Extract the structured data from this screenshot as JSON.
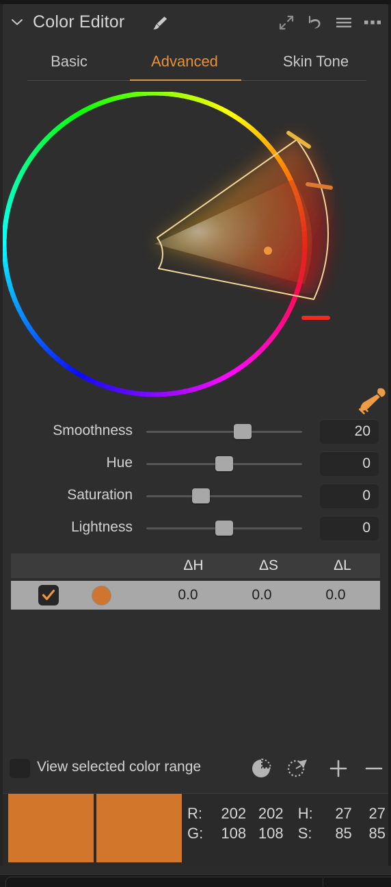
{
  "header": {
    "title": "Color Editor",
    "collapse_icon": "chevron-down-icon",
    "brush_icon": "paintbrush-icon",
    "actions": [
      {
        "name": "expand-icon",
        "label": "Expand"
      },
      {
        "name": "reset-icon",
        "label": "Reset"
      },
      {
        "name": "menu-icon",
        "label": "Menu"
      },
      {
        "name": "more-icon",
        "label": "More"
      }
    ]
  },
  "tabs": [
    {
      "label": "Basic",
      "active": false
    },
    {
      "label": "Advanced",
      "active": true
    },
    {
      "label": "Skin Tone",
      "active": false
    }
  ],
  "wheel": {
    "eyedropper_icon": "eyedropper-icon",
    "selection": {
      "start_angle_deg": -52,
      "end_angle_deg": 2,
      "inner_radius_pct": 26,
      "outer_radius_pct": 100,
      "handle_angles_deg": [
        -52,
        -24,
        2
      ],
      "point_marker": {
        "angle_deg": -20,
        "radius_pct": 66
      }
    }
  },
  "sliders": [
    {
      "label": "Smoothness",
      "value": "20",
      "position_pct": 62
    },
    {
      "label": "Hue",
      "value": "0",
      "position_pct": 50
    },
    {
      "label": "Saturation",
      "value": "0",
      "position_pct": 35
    },
    {
      "label": "Lightness",
      "value": "0",
      "position_pct": 50
    }
  ],
  "table": {
    "headers": [
      "",
      "",
      "ΔH",
      "ΔS",
      "ΔL"
    ],
    "rows": [
      {
        "enabled": true,
        "swatch_color": "#cf7530",
        "dh": "0.0",
        "ds": "0.0",
        "dl": "0.0"
      }
    ]
  },
  "view_range": {
    "checked": false,
    "label": "View selected color range",
    "icons": [
      {
        "name": "pie-range-icon",
        "label": "Show color wheel range"
      },
      {
        "name": "lasso-range-icon",
        "label": "Show picked range"
      },
      {
        "name": "add-icon",
        "label": "Add"
      },
      {
        "name": "remove-icon",
        "label": "Remove"
      }
    ]
  },
  "footer": {
    "swatch_before": "#d1762a",
    "swatch_after": "#d1762a",
    "values": [
      {
        "key": "R:",
        "c1": "202",
        "c2": "202",
        "key2": "H:",
        "c3": "27",
        "c4": "27"
      },
      {
        "key": "G:",
        "c1": "108",
        "c2": "108",
        "key2": "S:",
        "c3": "85",
        "c4": "85"
      }
    ]
  },
  "colors": {
    "accent": "#e8913c",
    "panel_bg": "#2e2e2e",
    "row_bg": "#a8a8a8",
    "header_row_bg": "#3c3c3c"
  }
}
